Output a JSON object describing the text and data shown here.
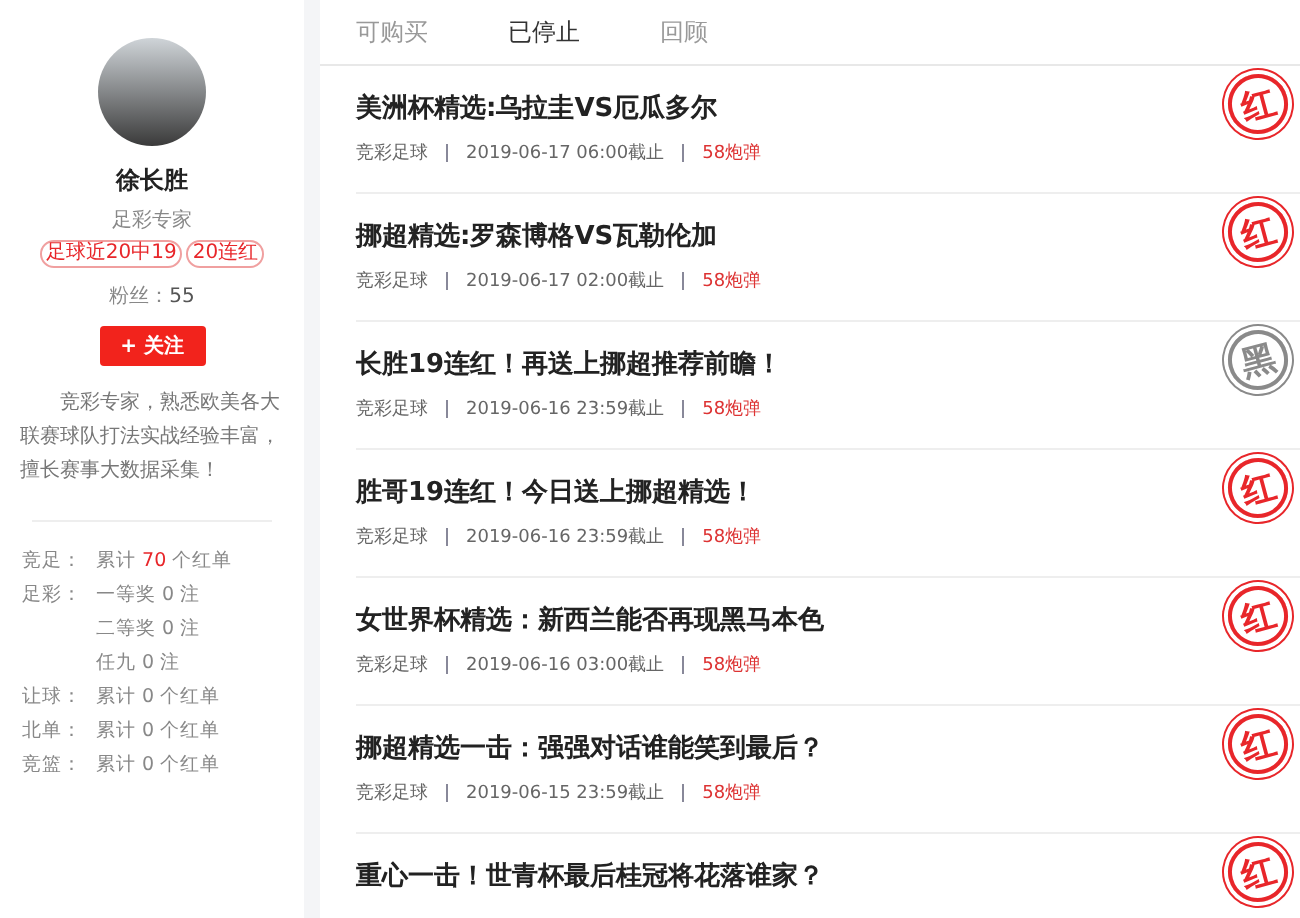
{
  "profile": {
    "name": "徐长胜",
    "title": "足彩专家",
    "badges": [
      "足球近20中19",
      "20连红"
    ],
    "fans_label": "粉丝：",
    "fans": "55",
    "follow_button": "+ 关注",
    "bio": "竞彩专家，熟悉欧美各大联赛球队打法实战经验丰富，擅长赛事大数据采集！"
  },
  "stats": [
    {
      "label": "竞足：",
      "lines": [
        [
          {
            "text": "累计 ",
            "highlight": false
          },
          {
            "text": "70",
            "highlight": true
          },
          {
            "text": " 个红单",
            "highlight": false
          }
        ]
      ]
    },
    {
      "label": "足彩：",
      "lines": [
        [
          {
            "text": "一等奖 0 注",
            "highlight": false
          }
        ],
        [
          {
            "text": "二等奖 0 注",
            "highlight": false
          }
        ],
        [
          {
            "text": "任九 0 注",
            "highlight": false
          }
        ]
      ]
    },
    {
      "label": "让球：",
      "lines": [
        [
          {
            "text": "累计 0 个红单",
            "highlight": false
          }
        ]
      ]
    },
    {
      "label": "北单：",
      "lines": [
        [
          {
            "text": "累计 0 个红单",
            "highlight": false
          }
        ]
      ]
    },
    {
      "label": "竞篮：",
      "lines": [
        [
          {
            "text": "累计 0 个红单",
            "highlight": false
          }
        ]
      ]
    }
  ],
  "tabs": [
    {
      "label": "可购买",
      "selected": false
    },
    {
      "label": "已停止",
      "selected": true
    },
    {
      "label": "回顾",
      "selected": false
    }
  ],
  "articles": [
    {
      "title": "美洲杯精选:乌拉圭VS厄瓜多尔",
      "category": "竞彩足球",
      "deadline": "2019-06-17 06:00截止",
      "price": "58炮弹",
      "result": "红",
      "kind": "red"
    },
    {
      "title": "挪超精选:罗森博格VS瓦勒伦加",
      "category": "竞彩足球",
      "deadline": "2019-06-17 02:00截止",
      "price": "58炮弹",
      "result": "红",
      "kind": "red"
    },
    {
      "title": "长胜19连红！再送上挪超推荐前瞻！",
      "category": "竞彩足球",
      "deadline": "2019-06-16 23:59截止",
      "price": "58炮弹",
      "result": "黑",
      "kind": "black"
    },
    {
      "title": "胜哥19连红！今日送上挪超精选！",
      "category": "竞彩足球",
      "deadline": "2019-06-16 23:59截止",
      "price": "58炮弹",
      "result": "红",
      "kind": "red"
    },
    {
      "title": "女世界杯精选：新西兰能否再现黑马本色",
      "category": "竞彩足球",
      "deadline": "2019-06-16 03:00截止",
      "price": "58炮弹",
      "result": "红",
      "kind": "red"
    },
    {
      "title": "挪超精选一击：强强对话谁能笑到最后？",
      "category": "竞彩足球",
      "deadline": "2019-06-15 23:59截止",
      "price": "58炮弹",
      "result": "红",
      "kind": "red"
    },
    {
      "title": "重心一击！世青杯最后桂冠将花落谁家？",
      "result": "红",
      "kind": "red"
    }
  ]
}
